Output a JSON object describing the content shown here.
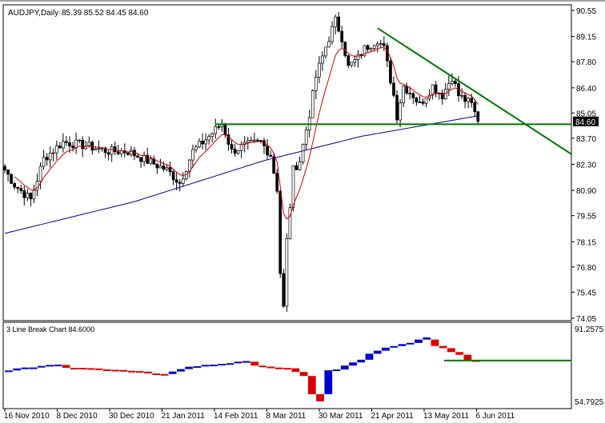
{
  "header": {
    "title": "AUDJPY,Daily",
    "ohlc": "85.39 85.52 84.45 84.60"
  },
  "sub": {
    "title": "3 Line Break Chart 84.6000",
    "axis_top": "91.2575",
    "axis_bottom": "54.7925"
  },
  "colors": {
    "up": "#0000cc",
    "down": "#dd0000",
    "ma_fast": "#cc0000",
    "ma_slow": "#000088",
    "line": "#007700",
    "price_tag": "#000000"
  },
  "chart_data": {
    "type": "candlestick",
    "symbol": "AUDJPY",
    "timeframe": "Daily",
    "last_price": "84.60",
    "ylim": [
      74.05,
      90.55
    ],
    "y_ticks": [
      "90.55",
      "89.15",
      "87.80",
      "86.40",
      "85.05",
      "83.70",
      "82.30",
      "80.90",
      "79.55",
      "78.15",
      "76.80",
      "75.45",
      "74.05"
    ],
    "x_ticks": [
      "16 Nov 2010",
      "8 Dec 2010",
      "30 Dec 2010",
      "21 Jan 2011",
      "14 Feb 2011",
      "8 Mar 2011",
      "30 Mar 2011",
      "21 Apr 2011",
      "13 May 2011",
      "6 Jun 2011"
    ],
    "close_keypoints": [
      [
        0,
        82.0
      ],
      [
        3,
        81.2
      ],
      [
        8,
        80.4
      ],
      [
        12,
        82.6
      ],
      [
        18,
        83.5
      ],
      [
        25,
        83.3
      ],
      [
        32,
        83.0
      ],
      [
        38,
        83.0
      ],
      [
        45,
        82.4
      ],
      [
        50,
        82.0
      ],
      [
        54,
        81.3
      ],
      [
        58,
        83.0
      ],
      [
        63,
        83.8
      ],
      [
        67,
        84.5
      ],
      [
        70,
        83.0
      ],
      [
        74,
        83.3
      ],
      [
        79,
        83.5
      ],
      [
        82,
        82.8
      ],
      [
        84,
        81.0
      ],
      [
        85,
        76.5
      ],
      [
        86,
        74.6
      ],
      [
        87,
        78.2
      ],
      [
        89,
        82.0
      ],
      [
        91,
        82.5
      ],
      [
        94,
        85.0
      ],
      [
        96,
        87.0
      ],
      [
        99,
        88.6
      ],
      [
        102,
        90.0
      ],
      [
        104,
        89.1
      ],
      [
        106,
        87.5
      ],
      [
        109,
        88.0
      ],
      [
        111,
        88.5
      ],
      [
        115,
        89.0
      ],
      [
        117,
        88.5
      ],
      [
        120,
        86.0
      ],
      [
        121,
        84.9
      ],
      [
        123,
        86.5
      ],
      [
        126,
        86.0
      ],
      [
        128,
        85.5
      ],
      [
        132,
        86.5
      ],
      [
        135,
        86.0
      ],
      [
        138,
        87.0
      ],
      [
        140,
        86.0
      ],
      [
        144,
        85.5
      ],
      [
        146,
        84.6
      ]
    ],
    "ma_slow_keypoints": [
      [
        0,
        78.6
      ],
      [
        40,
        80.3
      ],
      [
        80,
        82.5
      ],
      [
        110,
        83.8
      ],
      [
        146,
        84.9
      ]
    ],
    "support_level": 84.45,
    "trendline": [
      [
        115,
        89.6
      ],
      [
        146,
        86.1
      ]
    ]
  }
}
